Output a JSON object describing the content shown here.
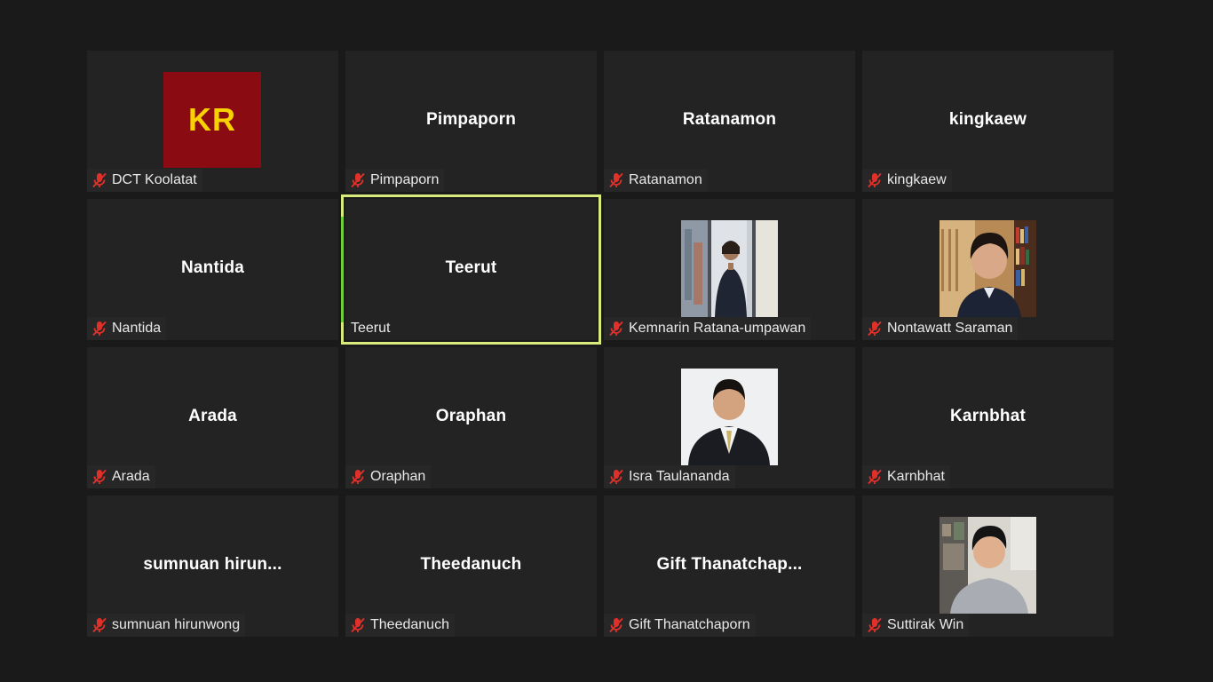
{
  "tiles": [
    {
      "name": "DCT Koolatat",
      "display": "",
      "avatar_initials": "KR",
      "avatar_bg": "#8b0b12",
      "avatar_fg": "#f7d100",
      "muted": true
    },
    {
      "name": "Pimpaporn",
      "display": "Pimpaporn",
      "muted": true
    },
    {
      "name": "Ratanamon",
      "display": "Ratanamon",
      "muted": true
    },
    {
      "name": "kingkaew",
      "display": "kingkaew",
      "muted": true
    },
    {
      "name": "Nantida",
      "display": "Nantida",
      "muted": true
    },
    {
      "name": "Teerut",
      "display": "Teerut",
      "muted": false,
      "active_speaker": true
    },
    {
      "name": "Kemnarin Ratana-umpawan",
      "display": "",
      "video": "person-city-window",
      "muted": true
    },
    {
      "name": "Nontawatt Saraman",
      "display": "",
      "video": "person-bookshelf",
      "muted": true
    },
    {
      "name": "Arada",
      "display": "Arada",
      "muted": true
    },
    {
      "name": "Oraphan",
      "display": "Oraphan",
      "muted": true
    },
    {
      "name": "Isra Taulananda",
      "display": "",
      "video": "person-suit-portrait",
      "muted": true
    },
    {
      "name": "Karnbhat",
      "display": "Karnbhat",
      "muted": true
    },
    {
      "name": "sumnuan hirunwong",
      "display": "sumnuan  hirun...",
      "muted": true
    },
    {
      "name": "Theedanuch",
      "display": "Theedanuch",
      "muted": true
    },
    {
      "name": "Gift Thanatchaporn",
      "display": "Gift  Thanatchap...",
      "muted": true
    },
    {
      "name": "Suttirak Win",
      "display": "",
      "video": "person-home-room",
      "muted": true
    }
  ],
  "colors": {
    "background": "#1a1a1a",
    "tile": "#232323",
    "active_border": "#d9eb7c",
    "muted_icon": "#e0302a"
  }
}
